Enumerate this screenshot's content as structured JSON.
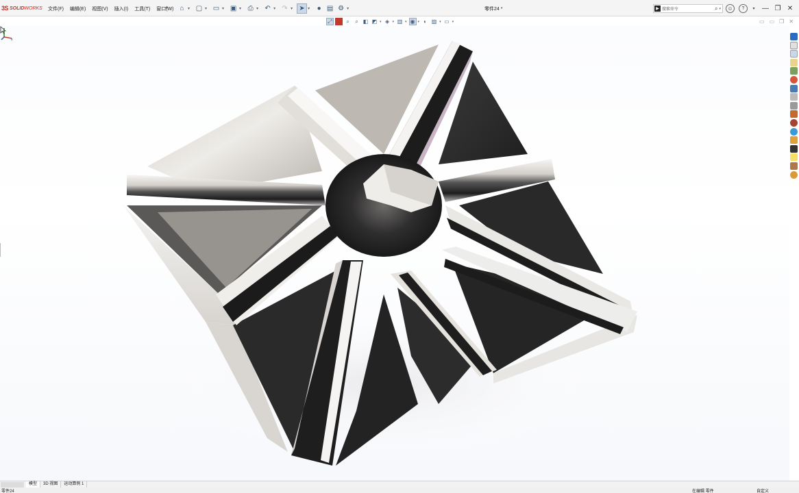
{
  "app": {
    "logo_ds": "3S",
    "logo_brand": "SOLID",
    "logo_brand2": "WORKS",
    "document_title": "零件24 *"
  },
  "menu": [
    "文件(F)",
    "编辑(E)",
    "视图(V)",
    "插入(I)",
    "工具(T)",
    "窗口(W)"
  ],
  "search": {
    "placeholder": "搜索命令"
  },
  "help_icons": [
    "?",
    "?"
  ],
  "window_controls": [
    "—",
    "❐",
    "✕"
  ],
  "bottom_tabs": [
    "模型",
    "3D 视图",
    "运动算例 1"
  ],
  "active_tab": "模型",
  "status": {
    "left": "零件24",
    "middle": "在编辑 零件",
    "right": "自定义"
  },
  "colors": {
    "accent_red": "#d52b1e",
    "viewport_bg": "#ffffff",
    "part_dark": "#2b2a2a",
    "part_light": "#e7e4df"
  },
  "icons": {
    "quick_access": [
      "home-icon",
      "new-file-icon",
      "open-icon",
      "save-icon",
      "print-icon",
      "undo-icon",
      "redo-icon",
      "select-icon",
      "rebuild-icon",
      "file-properties-icon",
      "options-icon"
    ],
    "view_toolbar": [
      "zoom-to-fit-icon",
      "zoom-to-area-icon",
      "previous-view-icon",
      "section-view-icon",
      "dynamic-annotation-icon",
      "view-orientation-icon",
      "display-style-icon",
      "hide-show-items-icon",
      "edit-appearance-icon",
      "apply-scene-icon",
      "view-settings-icon"
    ],
    "task_pane": [
      "solidworks-resources-icon",
      "home-icon",
      "design-library-icon",
      "file-explorer-icon",
      "view-palette-icon",
      "appearances-icon",
      "custom-properties-icon",
      "tools-icon",
      "toolbox-icon",
      "3dcontentcentral-icon",
      "forum-icon",
      "pdm-icon",
      "3dexperience-icon",
      "learn-icon",
      "plugins-icon",
      "settings-icon",
      "addins-icon"
    ]
  }
}
